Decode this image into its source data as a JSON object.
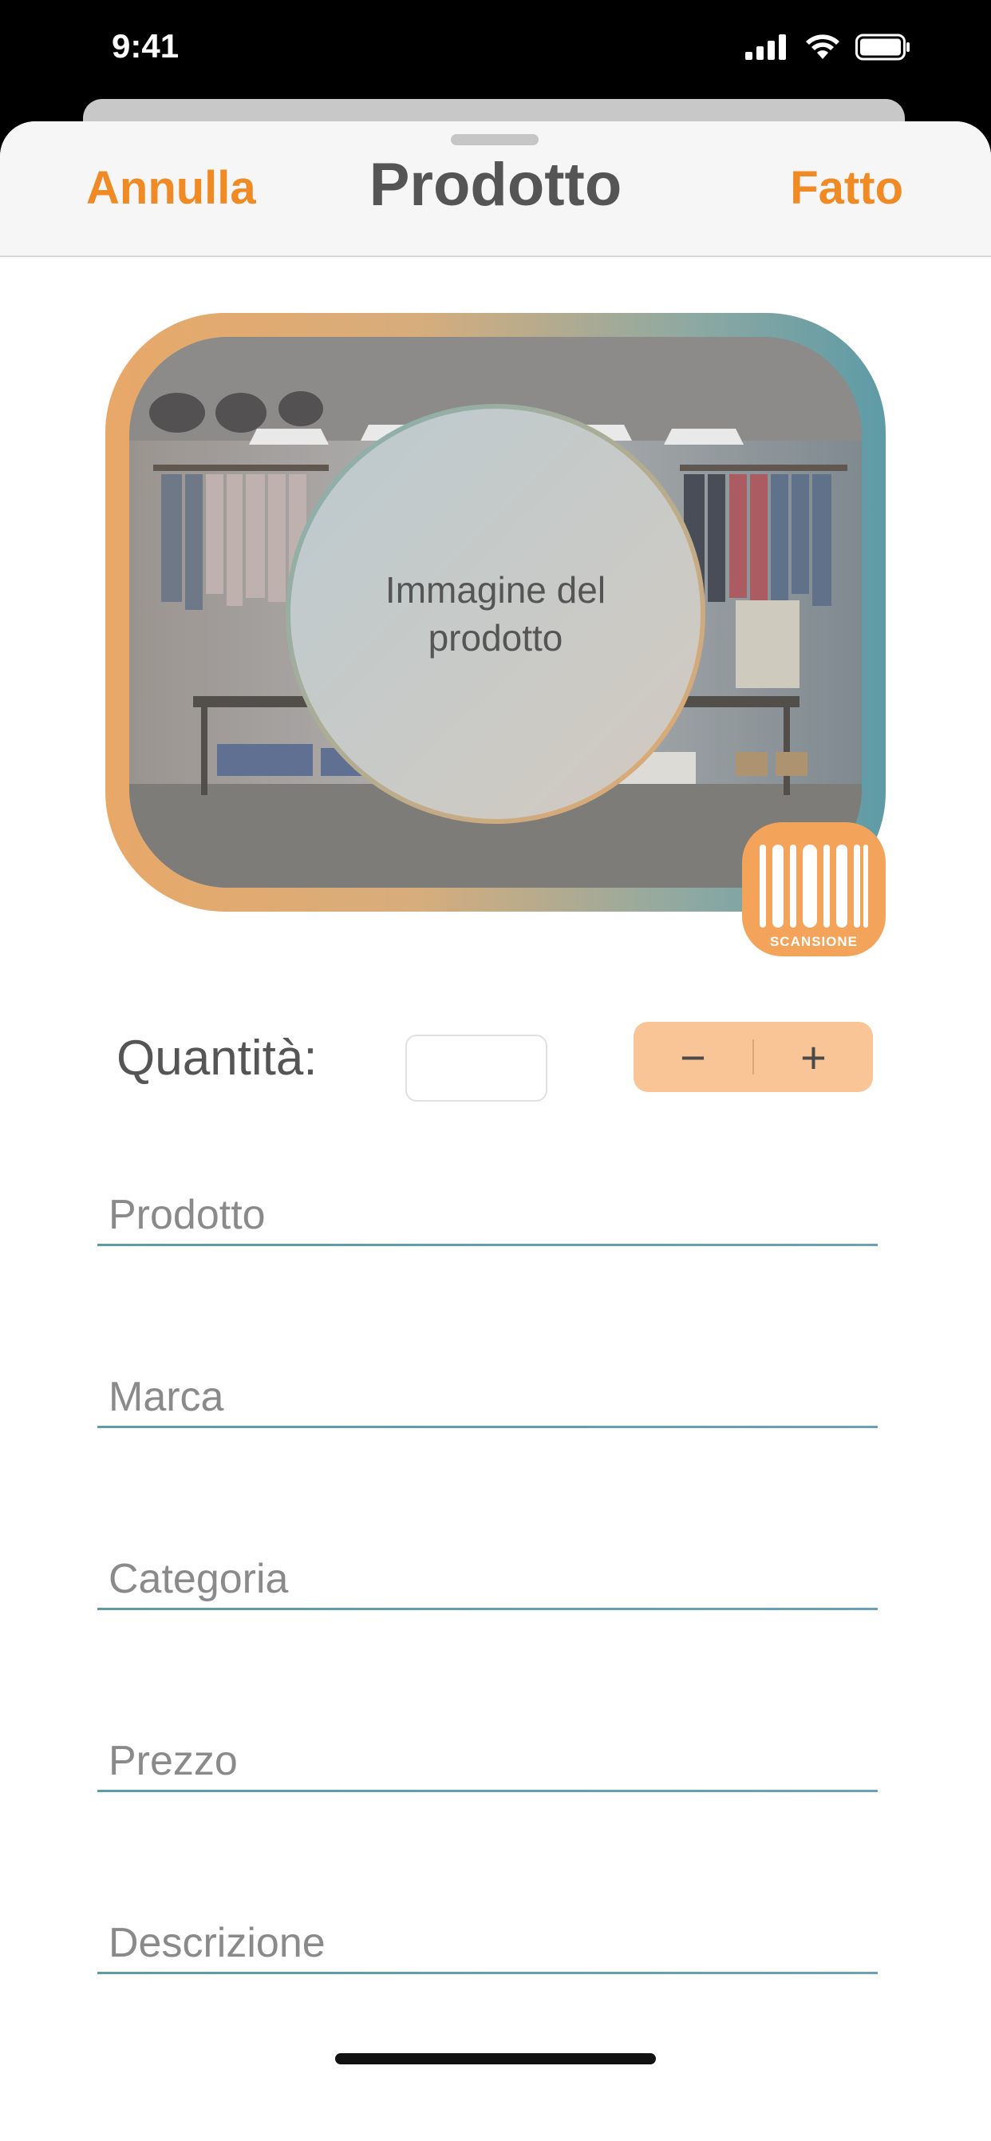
{
  "status_bar": {
    "time": "9:41",
    "icons": [
      "signal-icon",
      "wifi-icon",
      "battery-icon"
    ]
  },
  "nav": {
    "cancel_label": "Annulla",
    "title": "Prodotto",
    "done_label": "Fatto"
  },
  "image": {
    "placeholder_text": "Immagine del prodotto"
  },
  "scan": {
    "label": "SCANSIONE",
    "icon": "barcode-icon"
  },
  "quantity": {
    "label": "Quantità:",
    "value": "",
    "decrement": "−",
    "increment": "+"
  },
  "fields": {
    "product": {
      "placeholder": "Prodotto",
      "value": ""
    },
    "brand": {
      "placeholder": "Marca",
      "value": ""
    },
    "category": {
      "placeholder": "Categoria",
      "value": ""
    },
    "price": {
      "placeholder": "Prezzo",
      "value": ""
    },
    "description": {
      "placeholder": "Descrizione",
      "value": ""
    }
  },
  "colors": {
    "accent": "#f08a24",
    "stepper_bg": "#fac596",
    "line": "#5e9ba6",
    "scan_bg": "#f4a45a"
  }
}
